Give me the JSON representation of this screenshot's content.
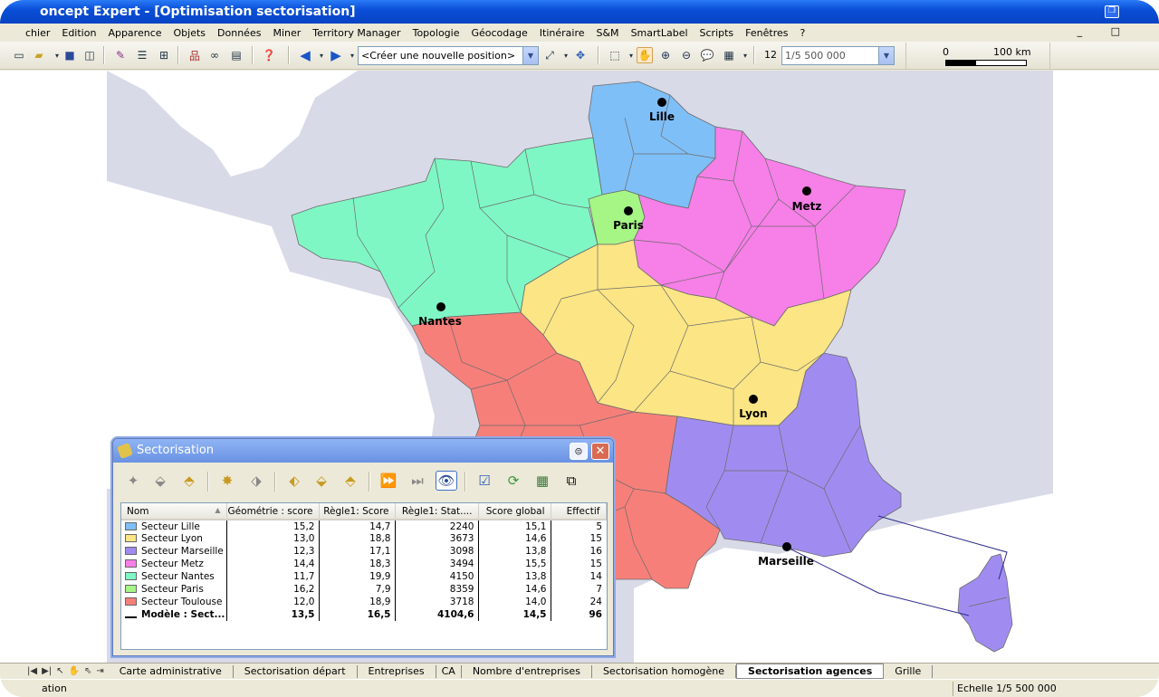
{
  "window": {
    "title": "oncept Expert - [Optimisation sectorisation]"
  },
  "menu": [
    "chier",
    "Edition",
    "Apparence",
    "Objets",
    "Données",
    "Miner",
    "Territory Manager",
    "Topologie",
    "Géocodage",
    "Itinéraire",
    "S&M",
    "SmartLabel",
    "Scripts",
    "Fenêtres",
    "?"
  ],
  "mdi_controls": "_ □",
  "toolbar": {
    "position_combo": "<Créer une nouvelle position>",
    "zoom_level": "12",
    "scale_combo": "1/5 500 000",
    "scalebar_start": "0",
    "scalebar_end": "100 km"
  },
  "colors": {
    "lille": "#7fbff7",
    "lyon": "#fbe585",
    "marseille": "#a08cf0",
    "metz": "#f77fe8",
    "nantes": "#7ff7c4",
    "paris": "#a5f685",
    "toulouse": "#f77f7a",
    "sea_land": "#d8dae8",
    "map_bg": "#ffffff"
  },
  "map": {
    "cities": [
      {
        "name": "Lille"
      },
      {
        "name": "Metz"
      },
      {
        "name": "Paris"
      },
      {
        "name": "Nantes"
      },
      {
        "name": "Lyon"
      },
      {
        "name": "Marseille"
      }
    ]
  },
  "dialog": {
    "title": "Sectorisation",
    "pin": "⊜",
    "close": "✕",
    "columns": [
      "Nom",
      "Géométrie : score",
      "Règle1: Score",
      "Règle1: Stat....",
      "Score global",
      "Effectif"
    ],
    "rows": [
      {
        "name": "Secteur Lille",
        "color": "#7fbff7",
        "geo": "15,2",
        "r1": "14,7",
        "stat": "2240",
        "global": "15,1",
        "eff": "5"
      },
      {
        "name": "Secteur Lyon",
        "color": "#fbe585",
        "geo": "13,0",
        "r1": "18,8",
        "stat": "3673",
        "global": "14,6",
        "eff": "15"
      },
      {
        "name": "Secteur Marseille",
        "color": "#a08cf0",
        "geo": "12,3",
        "r1": "17,1",
        "stat": "3098",
        "global": "13,8",
        "eff": "16"
      },
      {
        "name": "Secteur Metz",
        "color": "#f77fe8",
        "geo": "14,4",
        "r1": "18,3",
        "stat": "3494",
        "global": "15,5",
        "eff": "15"
      },
      {
        "name": "Secteur Nantes",
        "color": "#7ff7c4",
        "geo": "11,7",
        "r1": "19,9",
        "stat": "4150",
        "global": "13,8",
        "eff": "14"
      },
      {
        "name": "Secteur Paris",
        "color": "#a5f685",
        "geo": "16,2",
        "r1": "7,9",
        "stat": "8359",
        "global": "14,6",
        "eff": "7"
      },
      {
        "name": "Secteur Toulouse",
        "color": "#f77f7a",
        "geo": "12,0",
        "r1": "18,9",
        "stat": "3718",
        "global": "14,0",
        "eff": "24"
      }
    ],
    "total": {
      "name": "Modèle : Sect...",
      "geo": "13,5",
      "r1": "16,5",
      "stat": "4104,6",
      "global": "14,5",
      "eff": "96"
    }
  },
  "map_tabs": [
    "Carte administrative",
    "Sectorisation départ",
    "Entreprises",
    "CA",
    "Nombre d'entreprises",
    "Sectorisation homogène",
    "Sectorisation agences",
    "Grille"
  ],
  "active_tab": "Sectorisation agences",
  "status": {
    "left": "ation",
    "scale": "Echelle 1/5 500 000"
  }
}
